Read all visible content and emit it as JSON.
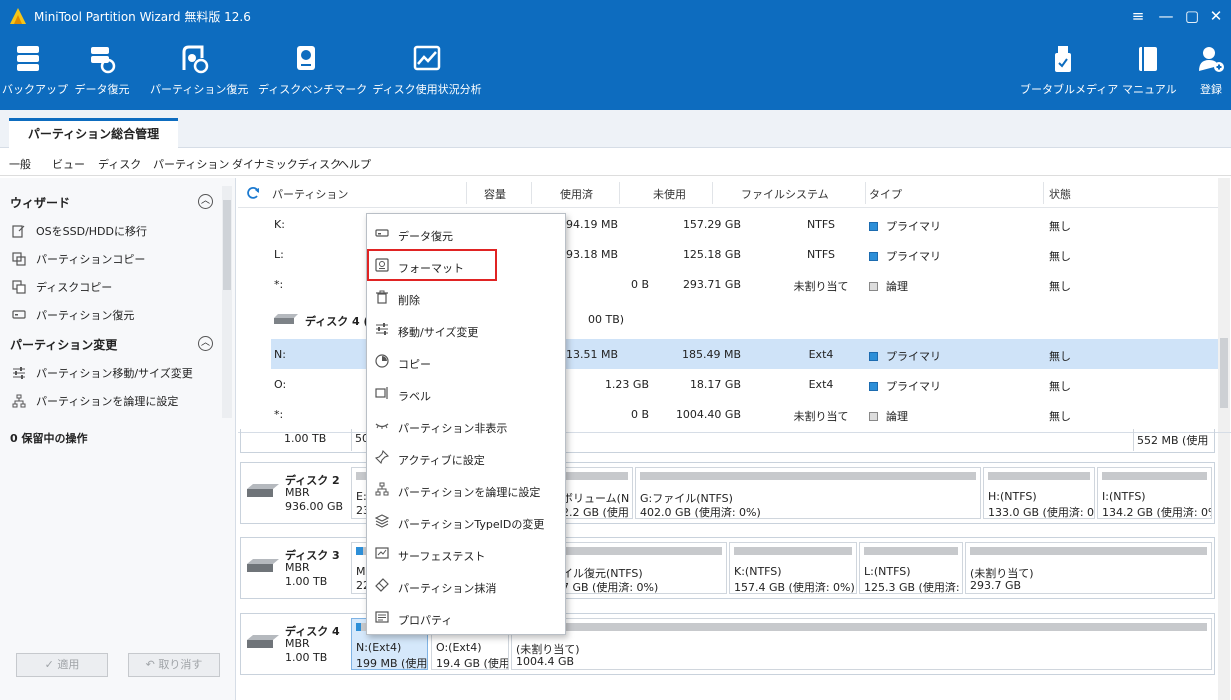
{
  "window": {
    "title": "MiniTool Partition Wizard 無料版 12.6",
    "controls": [
      "≡",
      "—",
      "▢",
      "✕"
    ]
  },
  "toolbar": {
    "items": [
      {
        "label": "バックアップ",
        "icon": "backup-icon"
      },
      {
        "label": "データ復元",
        "icon": "data-recovery-icon"
      },
      {
        "label": "パーティション復元",
        "icon": "partition-recovery-icon"
      },
      {
        "label": "ディスクベンチマーク",
        "icon": "disk-benchmark-icon"
      },
      {
        "label": "ディスク使用状況分析",
        "icon": "space-analyzer-icon"
      },
      {
        "label": "ブータブルメディア",
        "icon": "bootable-media-icon"
      },
      {
        "label": "マニュアル",
        "icon": "manual-icon"
      },
      {
        "label": "登録",
        "icon": "register-icon"
      }
    ]
  },
  "tab": {
    "label": "パーティション総合管理"
  },
  "menubar": {
    "items": [
      "一般",
      "ビュー",
      "ディスク",
      "パーティション",
      "ダイナミックディスク",
      "ヘルプ"
    ]
  },
  "leftpanel": {
    "wizard_title": "ウィザード",
    "wizard_items": [
      "OSをSSD/HDDに移行",
      "パーティションコピー",
      "ディスクコピー",
      "パーティション復元"
    ],
    "change_title": "パーティション変更",
    "change_items": [
      "パーティション移動/サイズ変更",
      "パーティションを論理に設定"
    ],
    "pending_title": "0 保留中の操作",
    "apply_label": "✓ 適用",
    "undo_label": "↶ 取り消す"
  },
  "table": {
    "headers": [
      "パーティション",
      "容量",
      "使用済",
      "未使用",
      "ファイルシステム",
      "タイプ",
      "状態"
    ],
    "rows": [
      {
        "part": "K:",
        "cap": "",
        "used": "94.19 MB",
        "free": "157.29 GB",
        "fs": "NTFS",
        "type": "プライマリ",
        "kind": "primary",
        "status": "無し"
      },
      {
        "part": "L:",
        "cap": "",
        "used": "93.18 MB",
        "free": "125.18 GB",
        "fs": "NTFS",
        "type": "プライマリ",
        "kind": "primary",
        "status": "無し"
      },
      {
        "part": "*:",
        "cap": "",
        "used": "0 B",
        "free": "293.71 GB",
        "fs": "未割り当て",
        "type": "論理",
        "kind": "logic",
        "status": "無し"
      }
    ],
    "disk4_label": "ディスク 4 (V",
    "disk4_size": "00 TB)",
    "rows2": [
      {
        "part": "N:",
        "cap": "",
        "used": "13.51 MB",
        "free": "185.49 MB",
        "fs": "Ext4",
        "type": "プライマリ",
        "kind": "primary",
        "status": "無し"
      },
      {
        "part": "O:",
        "cap": "",
        "used": "1.23 GB",
        "free": "18.17 GB",
        "fs": "Ext4",
        "type": "プライマリ",
        "kind": "primary",
        "status": "無し"
      },
      {
        "part": "*:",
        "cap": "",
        "used": "0 B",
        "free": "1004.40 GB",
        "fs": "未割り当て",
        "type": "論理",
        "kind": "logic",
        "status": "無し"
      }
    ]
  },
  "diskmap": {
    "disk1_partial": {
      "size": "1.00 TB",
      "p1": "50",
      "p_last": "552 MB (使用"
    },
    "disks": [
      {
        "name": "ディスク 2",
        "type": "MBR",
        "size": "936.00 GB",
        "parts": [
          {
            "l1": "E:",
            "l2": "23"
          },
          {
            "l1": "ボリューム(N",
            "l2": "2.2 GB (使用"
          },
          {
            "l1": "G:ファイル(NTFS)",
            "l2": "402.0 GB (使用済: 0%)"
          },
          {
            "l1": "H:(NTFS)",
            "l2": "133.0 GB (使用済: 0%"
          },
          {
            "l1": "I:(NTFS)",
            "l2": "134.2 GB (使用済: 0%"
          }
        ]
      },
      {
        "name": "ディスク 3",
        "type": "MBR",
        "size": "1.00 TB",
        "parts": [
          {
            "l1": "M",
            "l2": "22"
          },
          {
            "l1": "イル復元(NTFS)",
            "l2": "7 GB (使用済: 0%)"
          },
          {
            "l1": "K:(NTFS)",
            "l2": "157.4 GB (使用済: 0%)"
          },
          {
            "l1": "L:(NTFS)",
            "l2": "125.3 GB (使用済: 0%)"
          },
          {
            "l1": "(未割り当て)",
            "l2": "293.7 GB"
          }
        ]
      },
      {
        "name": "ディスク 4",
        "type": "MBR",
        "size": "1.00 TB",
        "parts": [
          {
            "l1": "N:(Ext4)",
            "l2": "199 MB (使用"
          },
          {
            "l1": "O:(Ext4)",
            "l2": "19.4 GB (使用"
          },
          {
            "l1": "(未割り当て)",
            "l2": "1004.4 GB"
          }
        ]
      }
    ]
  },
  "context_menu": {
    "items": [
      {
        "label": "データ復元",
        "icon": "data-recovery-icon"
      },
      {
        "label": "フォーマット",
        "icon": "format-icon"
      },
      {
        "label": "削除",
        "icon": "trash-icon"
      },
      {
        "label": "移動/サイズ変更",
        "icon": "resize-icon"
      },
      {
        "label": "コピー",
        "icon": "copy-icon"
      },
      {
        "label": "ラベル",
        "icon": "label-icon"
      },
      {
        "label": "パーティション非表示",
        "icon": "hide-icon"
      },
      {
        "label": "アクティブに設定",
        "icon": "pin-icon"
      },
      {
        "label": "パーティションを論理に設定",
        "icon": "logical-icon"
      },
      {
        "label": "パーティションTypeIDの変更",
        "icon": "layers-icon"
      },
      {
        "label": "サーフェステスト",
        "icon": "surface-test-icon"
      },
      {
        "label": "パーティション抹消",
        "icon": "eraser-icon"
      },
      {
        "label": "プロパティ",
        "icon": "properties-icon"
      }
    ],
    "highlighted_index": 1
  },
  "colors": {
    "brand": "#0d6cbf",
    "selection": "#cfe3f8",
    "primary_partition": "#2d8fd8",
    "highlight_box": "#e02323"
  }
}
